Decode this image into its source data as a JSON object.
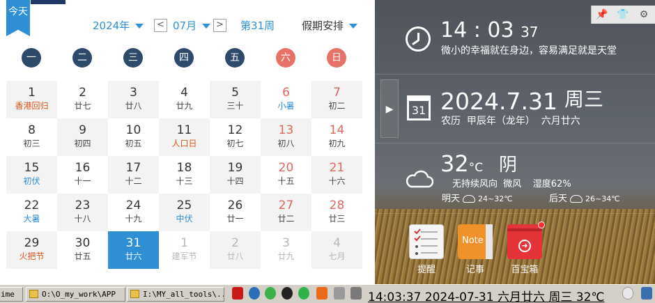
{
  "calendar": {
    "today_label": "今天",
    "year_select": "2024年",
    "prev": "<",
    "month_select": "07月",
    "next": ">",
    "week_number": "第31周",
    "holiday_select": "假期安排",
    "weekdays": [
      "一",
      "二",
      "三",
      "四",
      "五",
      "六",
      "日"
    ],
    "rows": [
      [
        {
          "d": "1",
          "s": "香港回归",
          "st": "red"
        },
        {
          "d": "2",
          "s": "廿七"
        },
        {
          "d": "3",
          "s": "廿八"
        },
        {
          "d": "4",
          "s": "廿九"
        },
        {
          "d": "5",
          "s": "三十"
        },
        {
          "d": "6",
          "s": "小暑",
          "st": "blue",
          "we": true
        },
        {
          "d": "7",
          "s": "初二",
          "we": true
        }
      ],
      [
        {
          "d": "8",
          "s": "初三"
        },
        {
          "d": "9",
          "s": "初四"
        },
        {
          "d": "10",
          "s": "初五"
        },
        {
          "d": "11",
          "s": "人口日",
          "st": "red"
        },
        {
          "d": "12",
          "s": "初七"
        },
        {
          "d": "13",
          "s": "初八",
          "we": true
        },
        {
          "d": "14",
          "s": "初九",
          "we": true
        }
      ],
      [
        {
          "d": "15",
          "s": "初伏",
          "st": "blue"
        },
        {
          "d": "16",
          "s": "十一"
        },
        {
          "d": "17",
          "s": "十二"
        },
        {
          "d": "18",
          "s": "十三"
        },
        {
          "d": "19",
          "s": "十四"
        },
        {
          "d": "20",
          "s": "十五",
          "we": true
        },
        {
          "d": "21",
          "s": "十六",
          "we": true
        }
      ],
      [
        {
          "d": "22",
          "s": "大暑",
          "st": "blue"
        },
        {
          "d": "23",
          "s": "十八"
        },
        {
          "d": "24",
          "s": "十九"
        },
        {
          "d": "25",
          "s": "中伏",
          "st": "blue"
        },
        {
          "d": "26",
          "s": "廿一"
        },
        {
          "d": "27",
          "s": "廿二",
          "we": true
        },
        {
          "d": "28",
          "s": "廿三",
          "we": true
        }
      ],
      [
        {
          "d": "29",
          "s": "火把节",
          "st": "red"
        },
        {
          "d": "30",
          "s": "廿五"
        },
        {
          "d": "31",
          "s": "廿六",
          "sel": true
        },
        {
          "d": "1",
          "s": "建军节",
          "other": true
        },
        {
          "d": "2",
          "s": "廿八",
          "other": true
        },
        {
          "d": "3",
          "s": "廿九",
          "other": true
        },
        {
          "d": "4",
          "s": "七月",
          "other": true
        }
      ]
    ]
  },
  "panel": {
    "time_hm": "14 : 03",
    "time_s": "37",
    "slogan": "微小的幸福就在身边，容易满足就是天堂",
    "date_big": "2024.7.31",
    "weekday_big": "周三",
    "cal_icon_day": "31",
    "lunar_line": "农历  甲辰年（龙年）  六月廿六",
    "temp": "32",
    "temp_unit": "°C",
    "weather": "阴",
    "wind_line": "无持续风向  微风    湿度62%",
    "tomorrow_label": "明天",
    "tomorrow_temp": "24~32℃",
    "dayafter_label": "后天",
    "dayafter_temp": "26~34℃",
    "apps": [
      "提醒",
      "记事",
      "百宝箱"
    ],
    "note_label": "Note",
    "top_icons": [
      "pin-icon",
      "shirt-icon",
      "gear-icon"
    ]
  },
  "taskbar": {
    "item0": "ime",
    "item1": "O:\\O_my_work\\APP",
    "item2": "I:\\MY_all_tools\\...",
    "clock": "14:03:37 2024-07-31 六月廿六 周三 32℃"
  }
}
